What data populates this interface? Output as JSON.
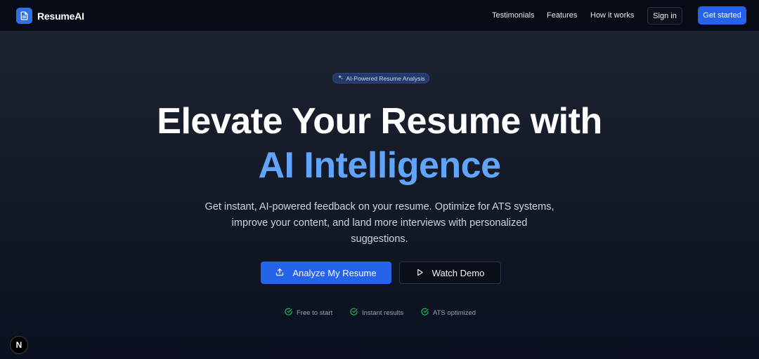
{
  "nav": {
    "brand": "ResumeAI",
    "links": [
      "Testimonials",
      "Features",
      "How it works"
    ],
    "sign_in": "Sign in",
    "get_started": "Get started"
  },
  "hero": {
    "badge": "AI-Powered Resume Analysis",
    "title_line1": "Elevate Your Resume with",
    "title_line2": "AI Intelligence",
    "description": "Get instant, AI-powered feedback on your resume. Optimize for ATS systems, improve your content, and land more interviews with personalized suggestions.",
    "primary_cta": "Analyze My Resume",
    "secondary_cta": "Watch Demo",
    "features": [
      "Free to start",
      "Instant results",
      "ATS optimized"
    ]
  },
  "dev_indicator": "N",
  "icons": {
    "logo": "document-icon",
    "badge": "sparkles-icon",
    "primary_cta": "upload-icon",
    "secondary_cta": "play-icon",
    "feature": "check-circle-icon"
  },
  "colors": {
    "accent": "#2563eb",
    "highlight": "#60a5fa",
    "check": "#22c55e"
  }
}
